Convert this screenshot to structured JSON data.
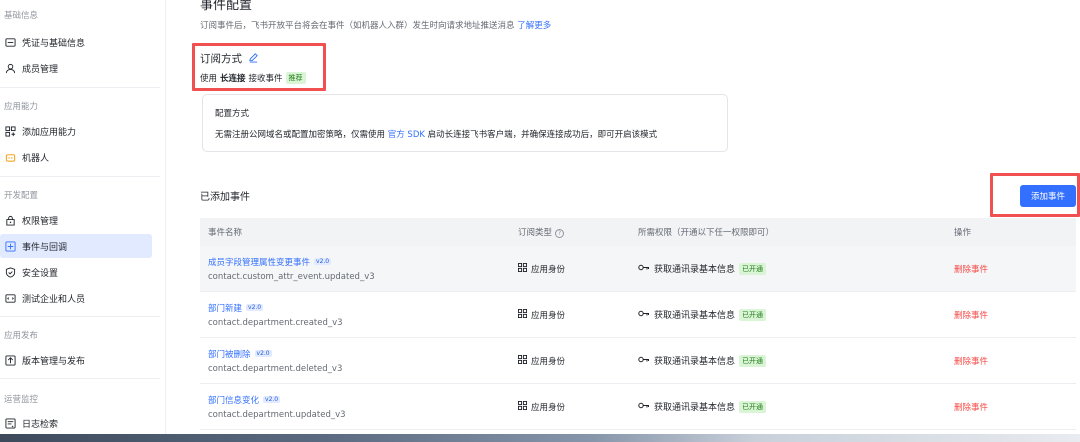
{
  "sidebar": {
    "groups": [
      {
        "label": "基础信息",
        "items": [
          {
            "label": "凭证与基础信息",
            "icon": "card-icon"
          },
          {
            "label": "成员管理",
            "icon": "user-icon"
          }
        ]
      },
      {
        "label": "应用能力",
        "items": [
          {
            "label": "添加应用能力",
            "icon": "grid-plus-icon"
          },
          {
            "label": "机器人",
            "icon": "robot-icon"
          }
        ]
      },
      {
        "label": "开发配置",
        "items": [
          {
            "label": "权限管理",
            "icon": "lock-icon"
          },
          {
            "label": "事件与回调",
            "icon": "event-icon",
            "active": true
          },
          {
            "label": "安全设置",
            "icon": "shield-icon"
          },
          {
            "label": "测试企业和人员",
            "icon": "test-icon"
          }
        ]
      },
      {
        "label": "应用发布",
        "items": [
          {
            "label": "版本管理与发布",
            "icon": "upload-icon"
          }
        ]
      },
      {
        "label": "运营监控",
        "items": [
          {
            "label": "日志检索",
            "icon": "log-icon"
          }
        ]
      }
    ]
  },
  "main": {
    "title": "事件配置",
    "desc": "订阅事件后，飞书开放平台将会在事件（如机器人入群）发生时向请求地址推送消息",
    "learn_more": "了解更多",
    "sub": {
      "title": "订阅方式",
      "prefix": "使用",
      "method": "长连接",
      "suffix": "接收事件",
      "tag": "推荐"
    },
    "config": {
      "title": "配置方式",
      "text_before": "无需注册公网域名或配置加密策略，仅需使用",
      "sdk_link": "官方 SDK",
      "text_after": "启动长连接飞书客户端，并确保连接成功后，即可开启该模式"
    },
    "added_title": "已添加事件",
    "add_button": "添加事件",
    "table": {
      "headers": [
        "事件名称",
        "订阅类型",
        "所需权限（开通以下任一权限即可）",
        "操作"
      ],
      "rows": [
        {
          "name": "成员字段管理属性变更事件",
          "version": "v2.0",
          "key": "contact.custom_attr_event.updated_v3",
          "type": "应用身份",
          "perm": "获取通讯录基本信息",
          "perm_tag": "已开通",
          "action": "删除事件"
        },
        {
          "name": "部门新建",
          "version": "v2.0",
          "key": "contact.department.created_v3",
          "type": "应用身份",
          "perm": "获取通讯录基本信息",
          "perm_tag": "已开通",
          "action": "删除事件"
        },
        {
          "name": "部门被删除",
          "version": "v2.0",
          "key": "contact.department.deleted_v3",
          "type": "应用身份",
          "perm": "获取通讯录基本信息",
          "perm_tag": "已开通",
          "action": "删除事件"
        },
        {
          "name": "部门信息变化",
          "version": "v2.0",
          "key": "contact.department.updated_v3",
          "type": "应用身份",
          "perm": "获取通讯录基本信息",
          "perm_tag": "已开通",
          "action": "删除事件"
        }
      ]
    }
  },
  "colors": {
    "accent": "#3370ff",
    "danger": "#f54a45",
    "highlight_box": "#f05050",
    "success_tag": "#d9f5d6"
  }
}
